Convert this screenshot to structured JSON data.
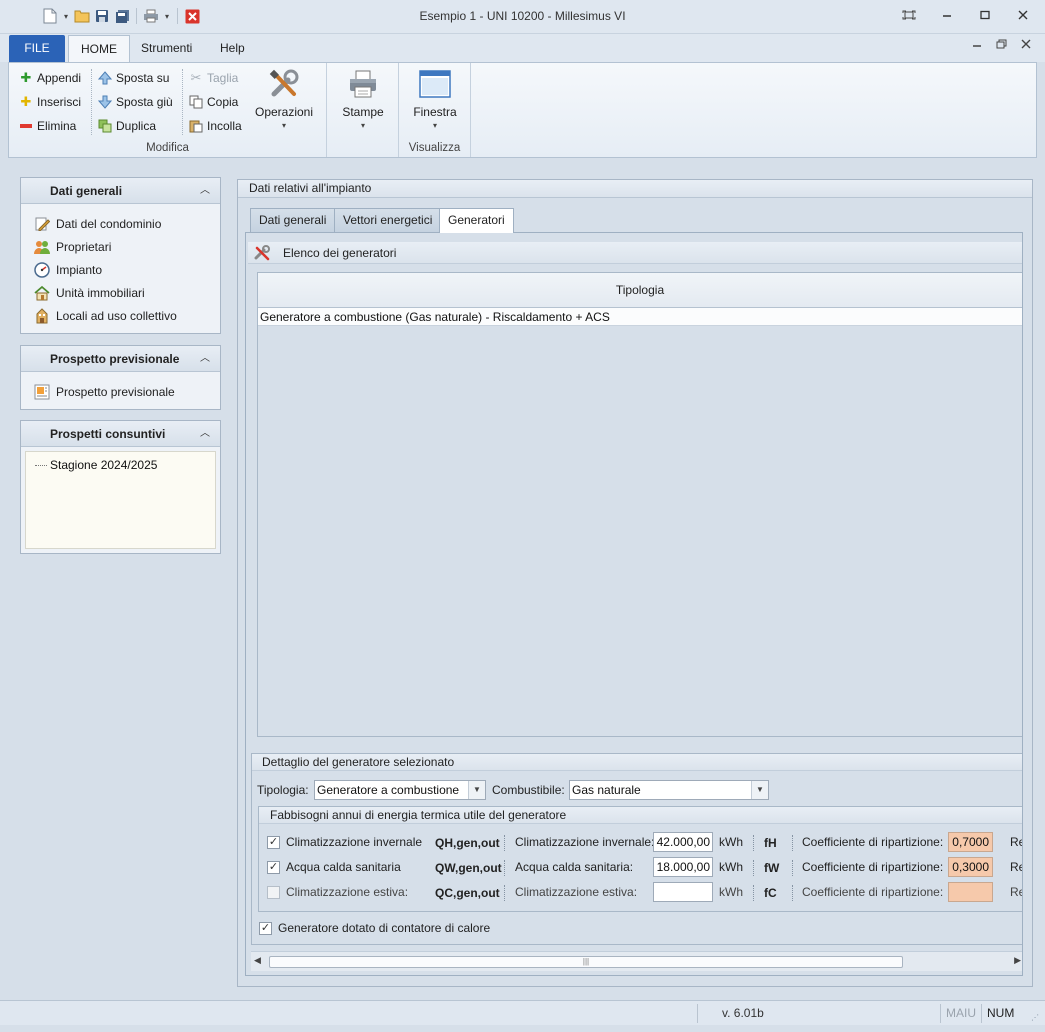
{
  "window": {
    "title": "Esempio 1 - UNI 10200 - Millesimus VI"
  },
  "ribbon_tabs": {
    "file": "FILE",
    "home": "HOME",
    "strumenti": "Strumenti",
    "help": "Help"
  },
  "ribbon": {
    "modifica": {
      "label": "Modifica",
      "appendi": "Appendi",
      "inserisci": "Inserisci",
      "elimina": "Elimina",
      "sposta_su": "Sposta su",
      "sposta_giu": "Sposta giù",
      "duplica": "Duplica",
      "taglia": "Taglia",
      "copia": "Copia",
      "incolla": "Incolla",
      "operazioni": "Operazioni"
    },
    "stampe": "Stampe",
    "visualizza": {
      "label": "Visualizza",
      "finestra": "Finestra"
    }
  },
  "left_panels": {
    "dati_generali": {
      "title": "Dati generali",
      "items": [
        {
          "label": "Dati del condominio",
          "icon": "pencil-document-icon"
        },
        {
          "label": "Proprietari",
          "icon": "users-icon"
        },
        {
          "label": "Impianto",
          "icon": "gauge-icon"
        },
        {
          "label": "Unità immobiliari",
          "icon": "house-icon"
        },
        {
          "label": "Locali ad uso collettivo",
          "icon": "building-icon"
        }
      ]
    },
    "prospetto_previsionale": {
      "title": "Prospetto previsionale",
      "items": [
        {
          "label": "Prospetto previsionale",
          "icon": "report-icon"
        }
      ]
    },
    "prospetti_consuntivi": {
      "title": "Prospetti consuntivi",
      "tree": [
        "Stagione 2024/2025"
      ]
    }
  },
  "main": {
    "group_title": "Dati relativi all'impianto",
    "tabs": [
      "Dati generali",
      "Vettori energetici",
      "Generatori"
    ],
    "active_tab": "Generatori",
    "elenco": {
      "title": "Elenco dei generatori",
      "column": "Tipologia",
      "rows": [
        "Generatore a combustione (Gas naturale) - Riscaldamento + ACS"
      ]
    },
    "dettaglio": {
      "title": "Dettaglio del generatore selezionato",
      "tipologia_label": "Tipologia:",
      "tipologia_value": "Generatore a combustione",
      "combustibile_label": "Combustibile:",
      "combustibile_value": "Gas naturale",
      "fabbisogni": {
        "title": "Fabbisogni annui di energia termica utile del generatore",
        "rows": [
          {
            "checked": true,
            "label": "Climatizzazione invernale",
            "symbol": "QH,gen,out",
            "label2": "Climatizzazione invernale:",
            "value": "42.000,00",
            "unit": "kWh",
            "f": "fH",
            "coef_label": "Coefficiente di ripartizione:",
            "coef": "0,7000",
            "trunc": "Re"
          },
          {
            "checked": true,
            "label": "Acqua calda sanitaria",
            "symbol": "QW,gen,out",
            "label2": "Acqua calda sanitaria:",
            "value": "18.000,00",
            "unit": "kWh",
            "f": "fW",
            "coef_label": "Coefficiente di ripartizione:",
            "coef": "0,3000",
            "trunc": "Re"
          },
          {
            "checked": false,
            "label": "Climatizzazione estiva:",
            "symbol": "QC,gen,out",
            "label2": "Climatizzazione estiva:",
            "value": "",
            "unit": "kWh",
            "f": "fC",
            "coef_label": "Coefficiente di ripartizione:",
            "coef": "",
            "trunc": "Re"
          }
        ]
      },
      "contatore_label": "Generatore dotato di contatore di calore",
      "contatore_checked": true
    }
  },
  "statusbar": {
    "version": "v. 6.01b",
    "maiu": "MAIU",
    "num": "NUM"
  }
}
